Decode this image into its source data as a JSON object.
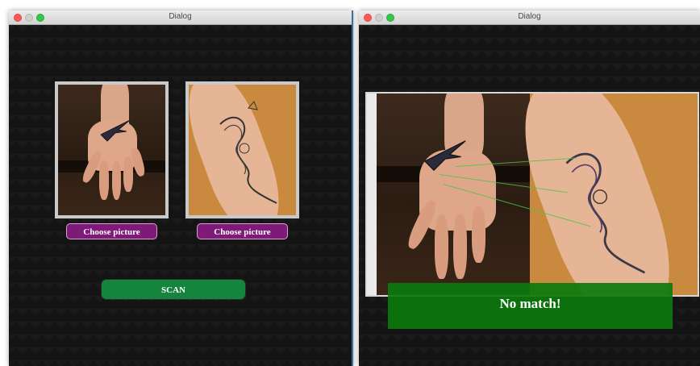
{
  "left_window": {
    "title": "Dialog",
    "choose_left_label": "Choose picture",
    "choose_right_label": "Choose picture",
    "scan_label": "SCAN"
  },
  "right_window": {
    "title": "Dialog",
    "result_text": "No match!"
  },
  "colors": {
    "choose_button_bg": "#7e1a78",
    "scan_button_bg": "#15843c",
    "result_banner_bg": "#0c780c",
    "window_bg": "#141414"
  },
  "icons": [
    "close-light",
    "minimize-light",
    "zoom-light"
  ]
}
